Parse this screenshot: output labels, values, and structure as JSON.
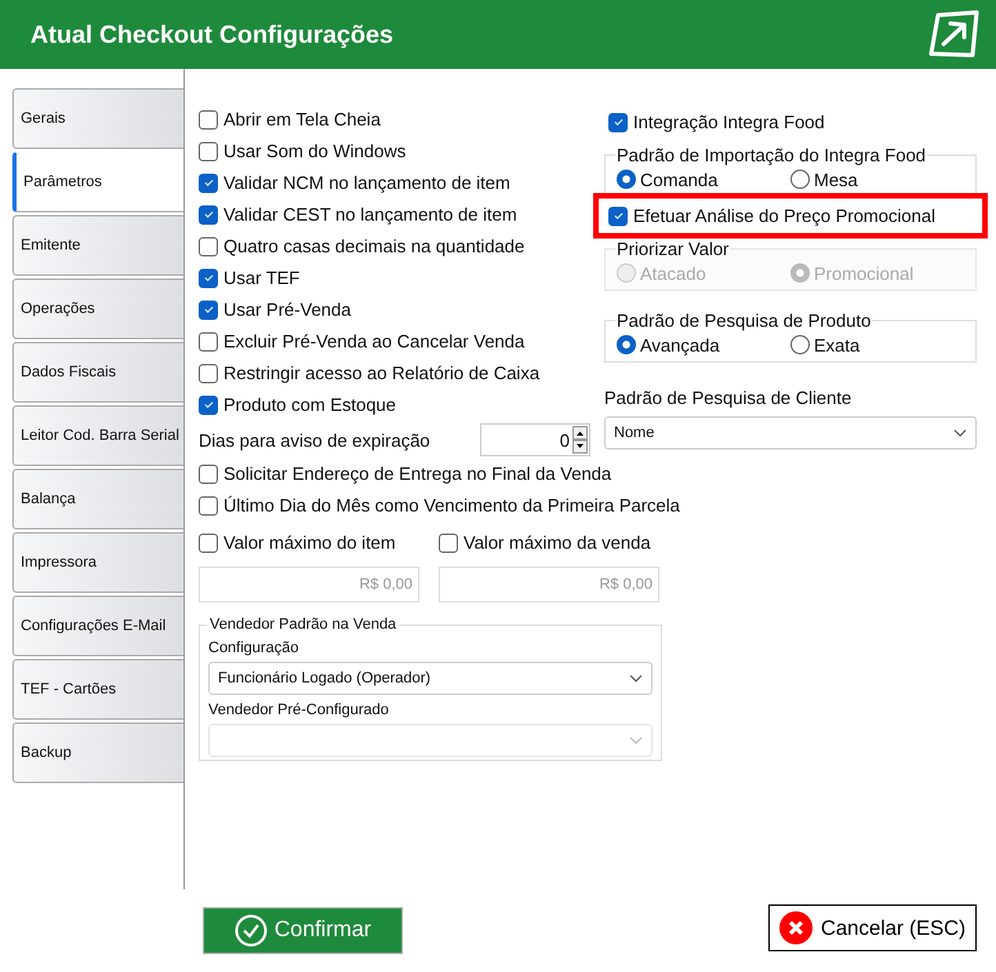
{
  "window": {
    "title": "Atual Checkout Configurações"
  },
  "tabs": [
    {
      "label": "Gerais",
      "selected": false
    },
    {
      "label": "Parâmetros",
      "selected": true
    },
    {
      "label": "Emitente",
      "selected": false
    },
    {
      "label": "Operações",
      "selected": false
    },
    {
      "label": "Dados Fiscais",
      "selected": false
    },
    {
      "label": "Leitor Cod. Barra Serial",
      "selected": false
    },
    {
      "label": "Balança",
      "selected": false
    },
    {
      "label": "Impressora",
      "selected": false
    },
    {
      "label": "Configurações E-Mail",
      "selected": false
    },
    {
      "label": "TEF - Cartões",
      "selected": false
    },
    {
      "label": "Backup",
      "selected": false
    }
  ],
  "options": [
    {
      "label": "Abrir em Tela Cheia",
      "checked": false
    },
    {
      "label": "Usar Som do Windows",
      "checked": false
    },
    {
      "label": "Validar NCM no lançamento de item",
      "checked": true
    },
    {
      "label": "Validar CEST no lançamento de item",
      "checked": true
    },
    {
      "label": "Quatro casas decimais na quantidade",
      "checked": false
    },
    {
      "label": "Usar TEF",
      "checked": true
    },
    {
      "label": "Usar Pré-Venda",
      "checked": true
    },
    {
      "label": "Excluir Pré-Venda ao Cancelar Venda",
      "checked": false
    },
    {
      "label": "Restringir acesso ao Relatório de Caixa",
      "checked": false
    },
    {
      "label": "Produto com Estoque",
      "checked": true
    }
  ],
  "expiry_days": {
    "label": "Dias para aviso de expiração",
    "value": "0"
  },
  "more_options": [
    {
      "label": "Solicitar Endereço de Entrega no Final da Venda",
      "checked": false
    },
    {
      "label": "Último Dia do Mês como Vencimento da Primeira Parcela",
      "checked": false
    }
  ],
  "max_values": [
    {
      "label": "Valor máximo do item",
      "checked": false,
      "value": "R$ 0,00"
    },
    {
      "label": "Valor máximo da venda",
      "checked": false,
      "value": "R$ 0,00"
    }
  ],
  "seller_group": {
    "title": "Vendedor Padrão na Venda",
    "fields": [
      {
        "label": "Configuração",
        "value": "Funcionário Logado (Operador)",
        "disabled": false
      },
      {
        "label": "Vendedor Pré-Configurado",
        "disabled": true
      }
    ]
  },
  "right": [
    {
      "kind": "checkbox",
      "label": "Integração Integra Food",
      "checked": true,
      "highlighted": false
    },
    {
      "kind": "radio_group",
      "title": "Padrão de Importação do Integra Food",
      "disabled": false,
      "options": [
        {
          "label": "Comanda",
          "selected": true
        },
        {
          "label": "Mesa",
          "selected": false
        }
      ]
    },
    {
      "kind": "checkbox",
      "label": "Efetuar Análise do Preço Promocional",
      "checked": true,
      "highlighted": true
    },
    {
      "kind": "radio_group",
      "title": "Priorizar Valor",
      "disabled": true,
      "options": [
        {
          "label": "Atacado",
          "selected": false
        },
        {
          "label": "Promocional",
          "selected": true
        }
      ]
    },
    {
      "kind": "radio_group",
      "title": "Padrão de Pesquisa de Produto",
      "disabled": false,
      "options": [
        {
          "label": "Avançada",
          "selected": true
        },
        {
          "label": "Exata",
          "selected": false
        }
      ]
    },
    {
      "kind": "select",
      "label": "Padrão de Pesquisa de Cliente",
      "value": "Nome"
    }
  ],
  "buttons": [
    {
      "kind": "confirm",
      "label": "Confirmar"
    },
    {
      "kind": "cancel",
      "label": "Cancelar (ESC)"
    }
  ]
}
